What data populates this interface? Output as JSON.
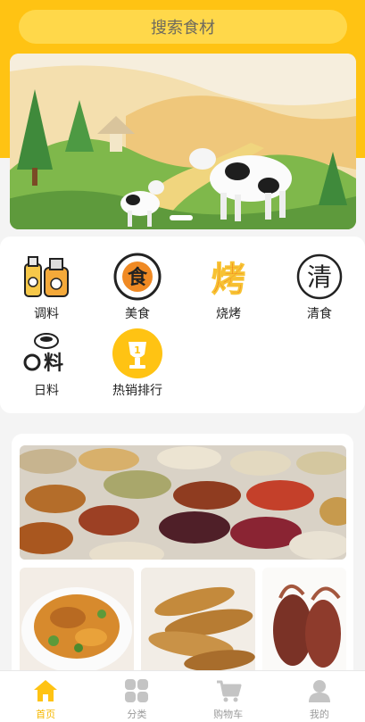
{
  "search": {
    "placeholder": "搜索食材"
  },
  "categories": [
    {
      "label": "调料",
      "icon": "seasoning-bottles-icon"
    },
    {
      "label": "美食",
      "icon": "food-character-icon"
    },
    {
      "label": "烧烤",
      "icon": "bbq-character-icon"
    },
    {
      "label": "清食",
      "icon": "light-food-character-icon"
    },
    {
      "label": "日料",
      "icon": "japanese-food-icon"
    },
    {
      "label": "热销排行",
      "icon": "trophy-icon",
      "badge": "1"
    }
  ],
  "tabs": [
    {
      "label": "首页",
      "icon": "home-icon",
      "active": true
    },
    {
      "label": "分类",
      "icon": "grid-icon",
      "active": false
    },
    {
      "label": "购物车",
      "icon": "cart-icon",
      "active": false
    },
    {
      "label": "我的",
      "icon": "user-icon",
      "active": false
    }
  ],
  "colors": {
    "accent": "#ffc313",
    "search_bg": "#ffd84a",
    "tab_active": "#f6b800",
    "tab_inactive": "#9a9a9a"
  }
}
